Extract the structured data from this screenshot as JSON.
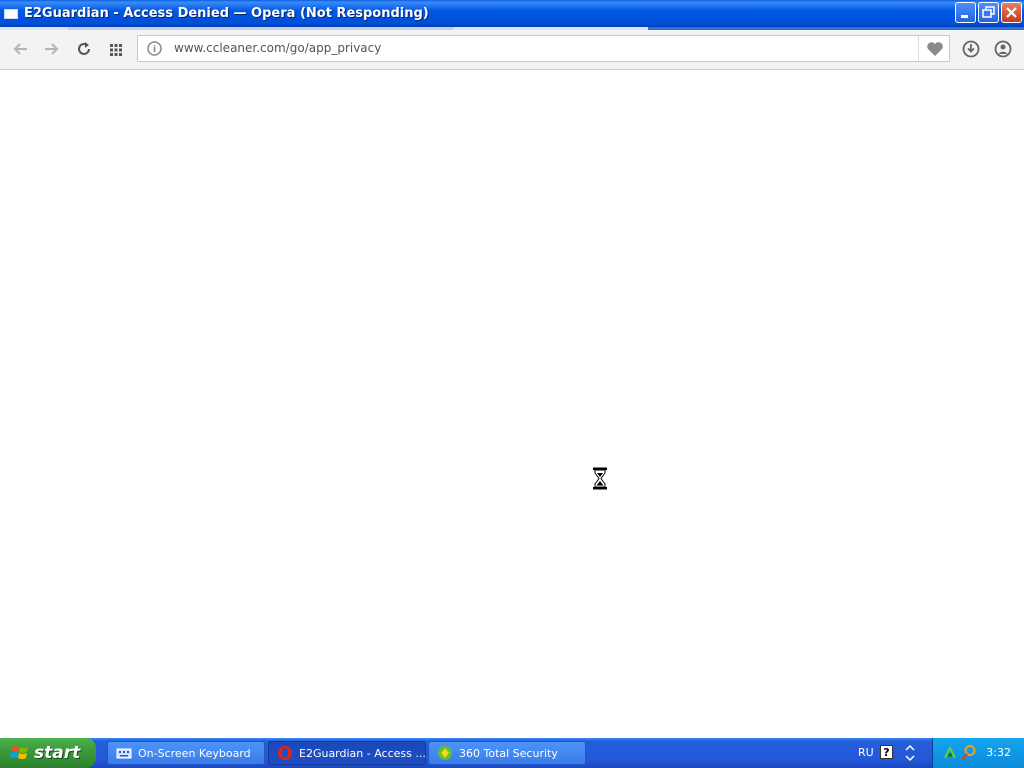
{
  "window": {
    "title": "E2Guardian - Access Denied — Opera (Not Responding)"
  },
  "toolbar": {
    "back_icon": "back-arrow-icon",
    "forward_icon": "forward-arrow-icon",
    "reload_icon": "reload-icon",
    "speed_dial_icon": "grid-icon",
    "site_info_icon": "site-info-icon",
    "url": "www.ccleaner.com/go/app_privacy",
    "bookmark_icon": "heart-icon",
    "download_icon": "download-icon",
    "account_icon": "account-icon"
  },
  "taskbar": {
    "start_label": "start",
    "tasks": [
      {
        "label": "On-Screen Keyboard",
        "icon": "keyboard-icon"
      },
      {
        "label": "E2Guardian - Access ...",
        "icon": "opera-icon"
      },
      {
        "label": "360 Total Security",
        "icon": "shield-icon"
      }
    ],
    "language": "RU",
    "help_label": "?",
    "clock": "3:32"
  },
  "colors": {
    "titlebar": "#0058e6",
    "taskbar": "#245edb",
    "start_button": "#3c9a3c",
    "tray": "#0c8ad8"
  }
}
